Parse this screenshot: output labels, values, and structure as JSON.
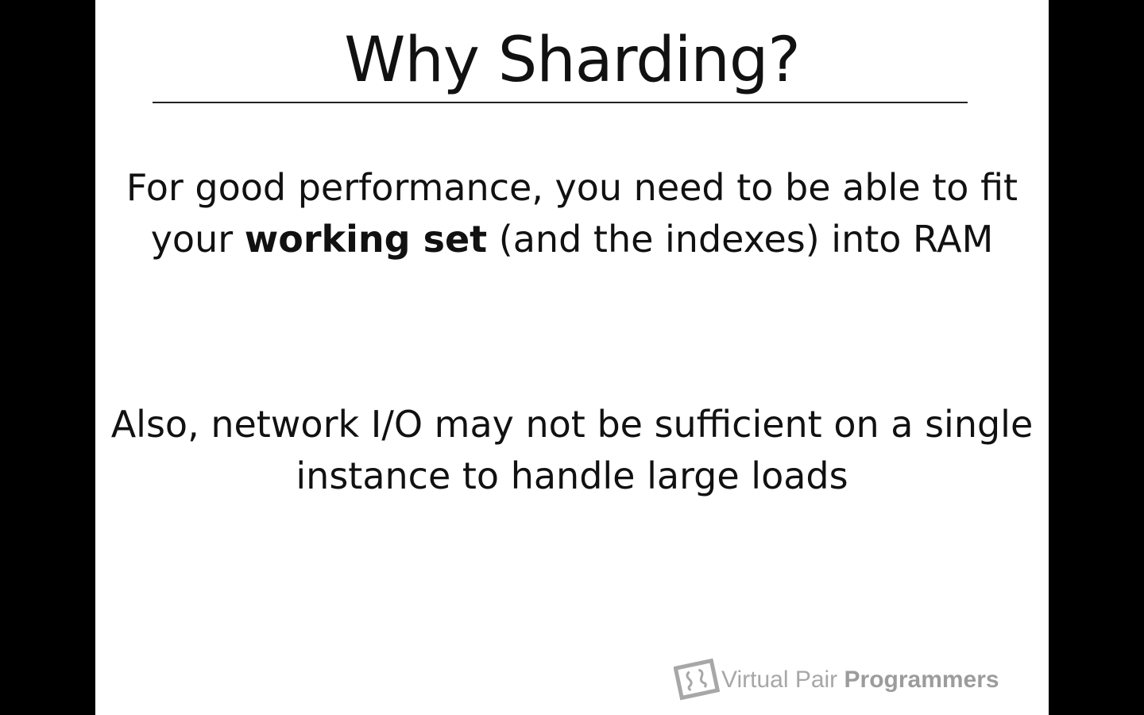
{
  "slide": {
    "title": "Why Sharding?",
    "paragraph1": {
      "before": "For good performance, you need to be able to fit your ",
      "bold": "working set",
      "after": " (and the indexes) into RAM"
    },
    "paragraph2": "Also, network I/O may not be sufficient on a single instance to handle large loads"
  },
  "branding": {
    "logo_icon": "vpp-logo-icon",
    "name_light": "Virtual Pair ",
    "name_bold": "Programmers"
  },
  "colors": {
    "background": "#000000",
    "slide": "#ffffff",
    "text": "#111111",
    "logo_gray": "#a7a7a7"
  }
}
